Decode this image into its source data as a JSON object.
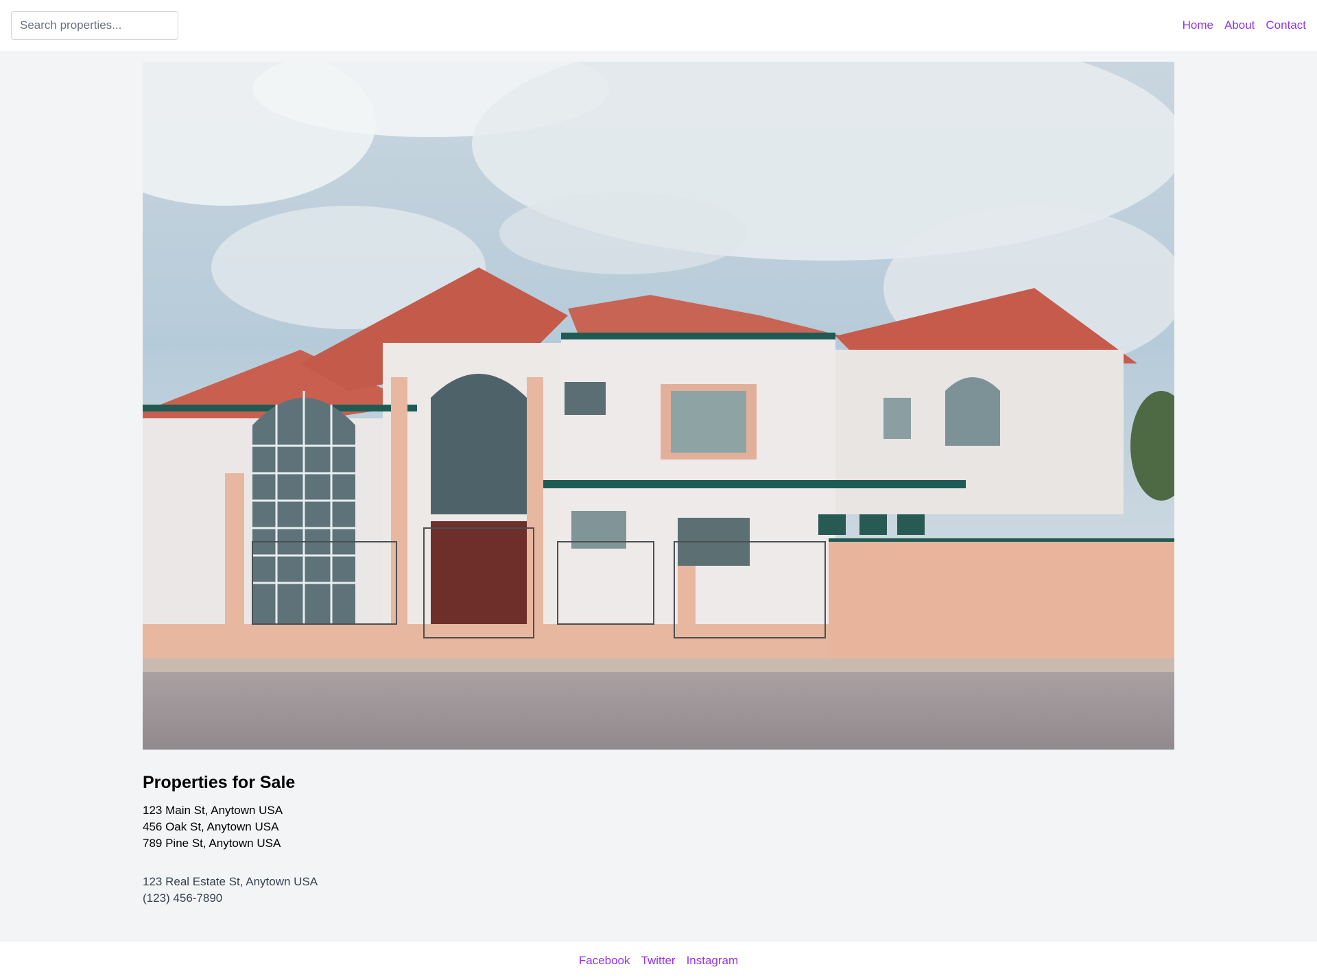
{
  "header": {
    "search_placeholder": "Search properties...",
    "nav": [
      {
        "label": "Home"
      },
      {
        "label": "About"
      },
      {
        "label": "Contact"
      }
    ]
  },
  "main": {
    "title": "Properties for Sale",
    "properties": [
      "123 Main St, Anytown USA",
      "456 Oak St, Anytown USA",
      "789 Pine St, Anytown USA"
    ],
    "contact": {
      "address": "123 Real Estate St, Anytown USA",
      "phone": "(123) 456-7890"
    }
  },
  "footer": {
    "links": [
      {
        "label": "Facebook"
      },
      {
        "label": "Twitter"
      },
      {
        "label": "Instagram"
      }
    ]
  },
  "colors": {
    "link": "#9333ea",
    "background": "#f3f4f6",
    "surface": "#ffffff",
    "muted_text": "#374151"
  }
}
